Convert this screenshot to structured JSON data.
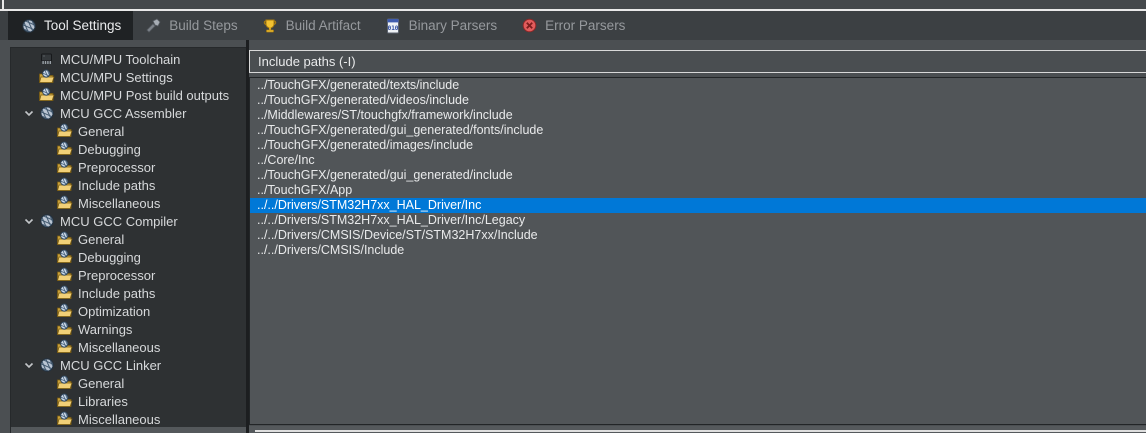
{
  "tabs": [
    {
      "label": "Tool Settings",
      "icon": "tool-settings-icon",
      "active": true
    },
    {
      "label": "Build Steps",
      "icon": "build-steps-icon",
      "active": false
    },
    {
      "label": "Build Artifact",
      "icon": "build-artifact-icon",
      "active": false
    },
    {
      "label": "Binary Parsers",
      "icon": "binary-parsers-icon",
      "active": false
    },
    {
      "label": "Error Parsers",
      "icon": "error-parsers-icon",
      "active": false
    }
  ],
  "tree": {
    "items": [
      {
        "label": "MCU/MPU Toolchain",
        "icon": "chip-icon",
        "level": 0,
        "expanded": null
      },
      {
        "label": "MCU/MPU Settings",
        "icon": "category-icon",
        "level": 0,
        "expanded": null
      },
      {
        "label": "MCU/MPU Post build outputs",
        "icon": "category-icon",
        "level": 0,
        "expanded": null
      },
      {
        "label": "MCU GCC Assembler",
        "icon": "tool-icon",
        "level": 0,
        "expanded": true
      },
      {
        "label": "General",
        "icon": "category-icon",
        "level": 1,
        "expanded": null
      },
      {
        "label": "Debugging",
        "icon": "category-icon",
        "level": 1,
        "expanded": null
      },
      {
        "label": "Preprocessor",
        "icon": "category-icon",
        "level": 1,
        "expanded": null
      },
      {
        "label": "Include paths",
        "icon": "category-icon",
        "level": 1,
        "expanded": null
      },
      {
        "label": "Miscellaneous",
        "icon": "category-icon",
        "level": 1,
        "expanded": null
      },
      {
        "label": "MCU GCC Compiler",
        "icon": "tool-icon",
        "level": 0,
        "expanded": true
      },
      {
        "label": "General",
        "icon": "category-icon",
        "level": 1,
        "expanded": null
      },
      {
        "label": "Debugging",
        "icon": "category-icon",
        "level": 1,
        "expanded": null
      },
      {
        "label": "Preprocessor",
        "icon": "category-icon",
        "level": 1,
        "expanded": null
      },
      {
        "label": "Include paths",
        "icon": "category-icon",
        "level": 1,
        "expanded": null
      },
      {
        "label": "Optimization",
        "icon": "category-icon",
        "level": 1,
        "expanded": null
      },
      {
        "label": "Warnings",
        "icon": "category-icon",
        "level": 1,
        "expanded": null
      },
      {
        "label": "Miscellaneous",
        "icon": "category-icon",
        "level": 1,
        "expanded": null
      },
      {
        "label": "MCU GCC Linker",
        "icon": "tool-icon",
        "level": 0,
        "expanded": true
      },
      {
        "label": "General",
        "icon": "category-icon",
        "level": 1,
        "expanded": null
      },
      {
        "label": "Libraries",
        "icon": "category-icon",
        "level": 1,
        "expanded": null
      },
      {
        "label": "Miscellaneous",
        "icon": "category-icon",
        "level": 1,
        "expanded": null
      }
    ]
  },
  "right_panel": {
    "header": "Include paths (-I)",
    "selected_index": 8,
    "paths": [
      "../TouchGFX/generated/texts/include",
      "../TouchGFX/generated/videos/include",
      "../Middlewares/ST/touchgfx/framework/include",
      "../TouchGFX/generated/gui_generated/fonts/include",
      "../TouchGFX/generated/images/include",
      "../Core/Inc",
      "../TouchGFX/generated/gui_generated/include",
      "../TouchGFX/App",
      "../../Drivers/STM32H7xx_HAL_Driver/Inc",
      "../../Drivers/STM32H7xx_HAL_Driver/Inc/Legacy",
      "../../Drivers/CMSIS/Device/ST/STM32H7xx/Include",
      "../../Drivers/CMSIS/Include"
    ]
  },
  "colors": {
    "selection": "#0078d7",
    "panel_bg": "#4b4f52",
    "tree_bg": "#2e3133",
    "tab_active_bg": "#1f2224"
  }
}
